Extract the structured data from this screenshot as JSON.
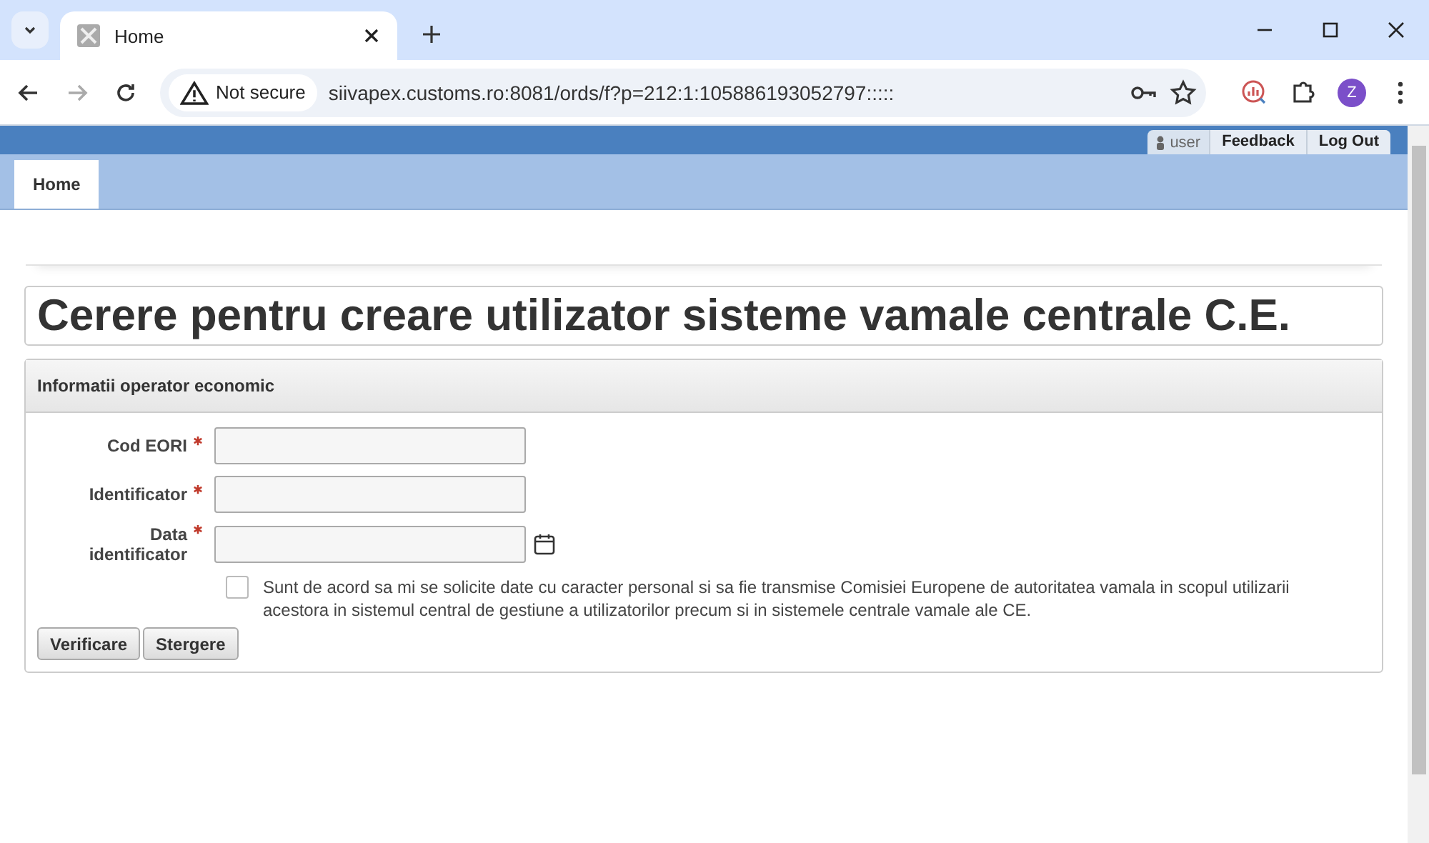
{
  "browser": {
    "tab": {
      "title": "Home",
      "selected": true
    },
    "security": "Not secure",
    "url": "siivapex.customs.ro:8081/ords/f?p=212:1:105886193052797:::::",
    "profile": "Z"
  },
  "header": {
    "user": "user",
    "links": [
      "Feedback",
      "Log Out"
    ]
  },
  "nav_tabs": [
    {
      "label": "Home",
      "selected": true
    }
  ],
  "page_title": "Cerere pentru creare utilizator sisteme vamale centrale C.E.",
  "region": {
    "title": "Informatii operator economic",
    "fields": [
      {
        "label": "Cod EORI",
        "required": true,
        "kind": "text"
      },
      {
        "label": "Identificator",
        "required": true,
        "kind": "text"
      },
      {
        "label": "Data identificator",
        "required": true,
        "kind": "date"
      }
    ],
    "consent": {
      "checked": false,
      "text": "Sunt de acord sa mi se solicite date cu caracter personal si sa fie transmise Comisiei Europene de autoritatea vamala in scopul utilizarii acestora in sistemul central de gestiune a utilizatorilor precum si in sistemele centrale vamale ale CE."
    },
    "buttons": [
      "Verificare",
      "Stergere"
    ]
  }
}
